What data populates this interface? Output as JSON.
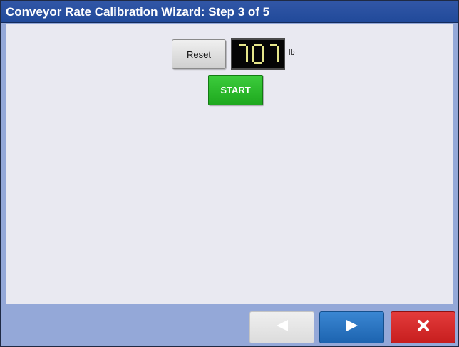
{
  "window": {
    "title": "Conveyor Rate Calibration Wizard: Step 3 of 5"
  },
  "controls": {
    "reset_label": "Reset",
    "counter_value": "707",
    "counter_unit": "lb",
    "start_label": "START"
  },
  "footer": {
    "back_icon": "left-triangle-icon",
    "next_icon": "right-triangle-icon",
    "cancel_icon": "close-x-icon"
  },
  "colors": {
    "title_bar": "#2a52a4",
    "start_green": "#2cbb2c",
    "next_blue": "#2a74c4",
    "cancel_red": "#d62b2b",
    "display_digits": "#e6e68a"
  }
}
